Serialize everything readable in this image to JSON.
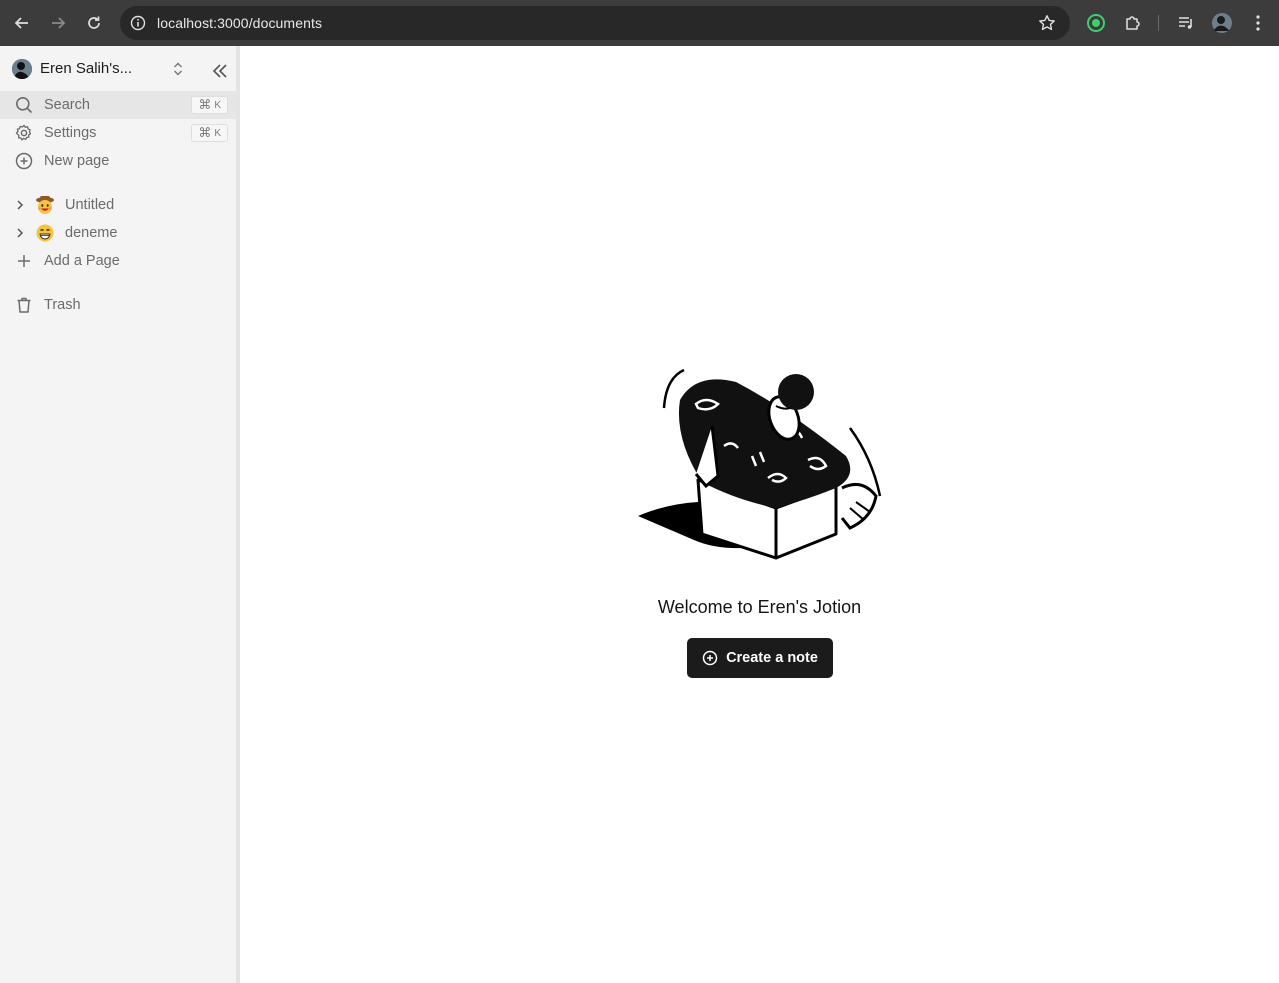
{
  "browser": {
    "url": "localhost:3000/documents"
  },
  "sidebar": {
    "workspace_name": "Eren Salih's...",
    "items": [
      {
        "label": "Search",
        "shortcut_key": "K",
        "shortcut_symbol": "⌘",
        "icon": "search-icon"
      },
      {
        "label": "Settings",
        "shortcut_key": "K",
        "shortcut_symbol": "⌘",
        "icon": "gear-icon"
      },
      {
        "label": "New page",
        "icon": "plus-circle-icon"
      }
    ],
    "documents": [
      {
        "title": "Untitled",
        "icon": "cowboy-face-emoji"
      },
      {
        "title": "deneme",
        "icon": "grinning-face-emoji"
      }
    ],
    "add_page_label": "Add a Page",
    "trash_label": "Trash"
  },
  "main": {
    "welcome_text": "Welcome to Eren's Jotion",
    "create_button_label": "Create a note"
  },
  "colors": {
    "sidebar_bg": "#f4f4f4",
    "button_bg": "#1b1b1b",
    "chrome_bg": "#3c3c3c"
  }
}
